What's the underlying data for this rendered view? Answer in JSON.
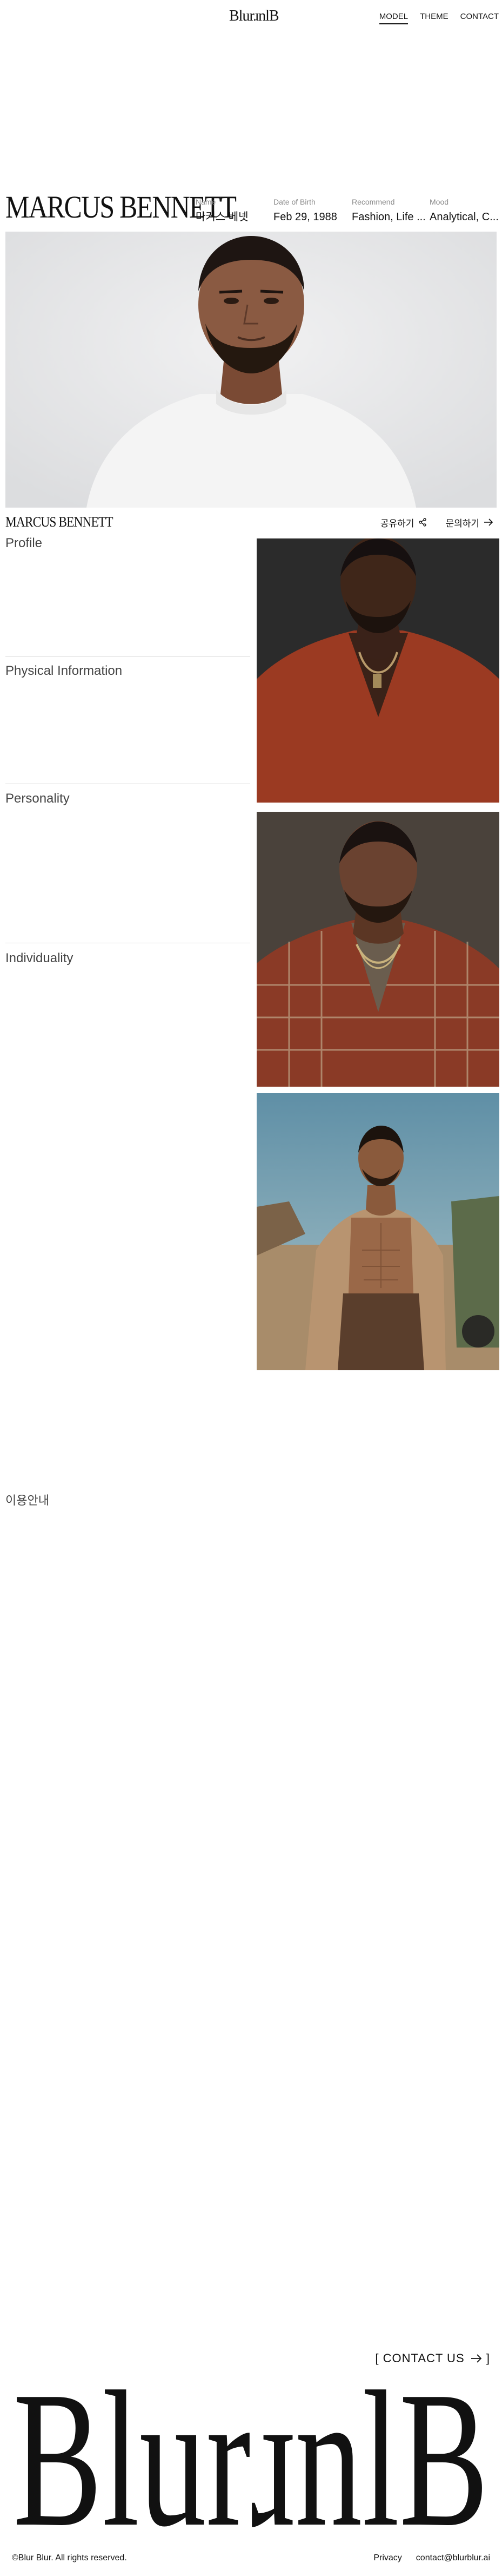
{
  "header": {
    "logo": "BlurɹnlB",
    "nav": [
      {
        "label": "MODEL",
        "active": true
      },
      {
        "label": "THEME",
        "active": false
      },
      {
        "label": "CONTACT",
        "active": false
      }
    ]
  },
  "model": {
    "name": "MARCUS BENNETT",
    "meta": [
      {
        "label": "Name",
        "value": "마커스 베넷"
      },
      {
        "label": "Date of Birth",
        "value": "Feb 29, 1988"
      },
      {
        "label": "Recommend",
        "value": "Fashion, Life ..."
      },
      {
        "label": "Mood",
        "value": "Analytical, C..."
      }
    ]
  },
  "subbar": {
    "title": "MARCUS BENNETT",
    "share_label": "공유하기",
    "inquiry_label": "문의하기"
  },
  "sections": {
    "profile": "Profile",
    "physical": "Physical Information",
    "personality": "Personality",
    "individuality": "Individuality"
  },
  "notice": "이용안내",
  "footer": {
    "contact_label": "[ CONTACT US",
    "copyright": "©Blur Blur. All rights reserved.",
    "privacy": "Privacy",
    "email": "contact@blurblur.ai",
    "logo": "BlurɹnlB"
  },
  "icons": {
    "share": "share-icon",
    "arrow": "arrow-right-icon"
  }
}
